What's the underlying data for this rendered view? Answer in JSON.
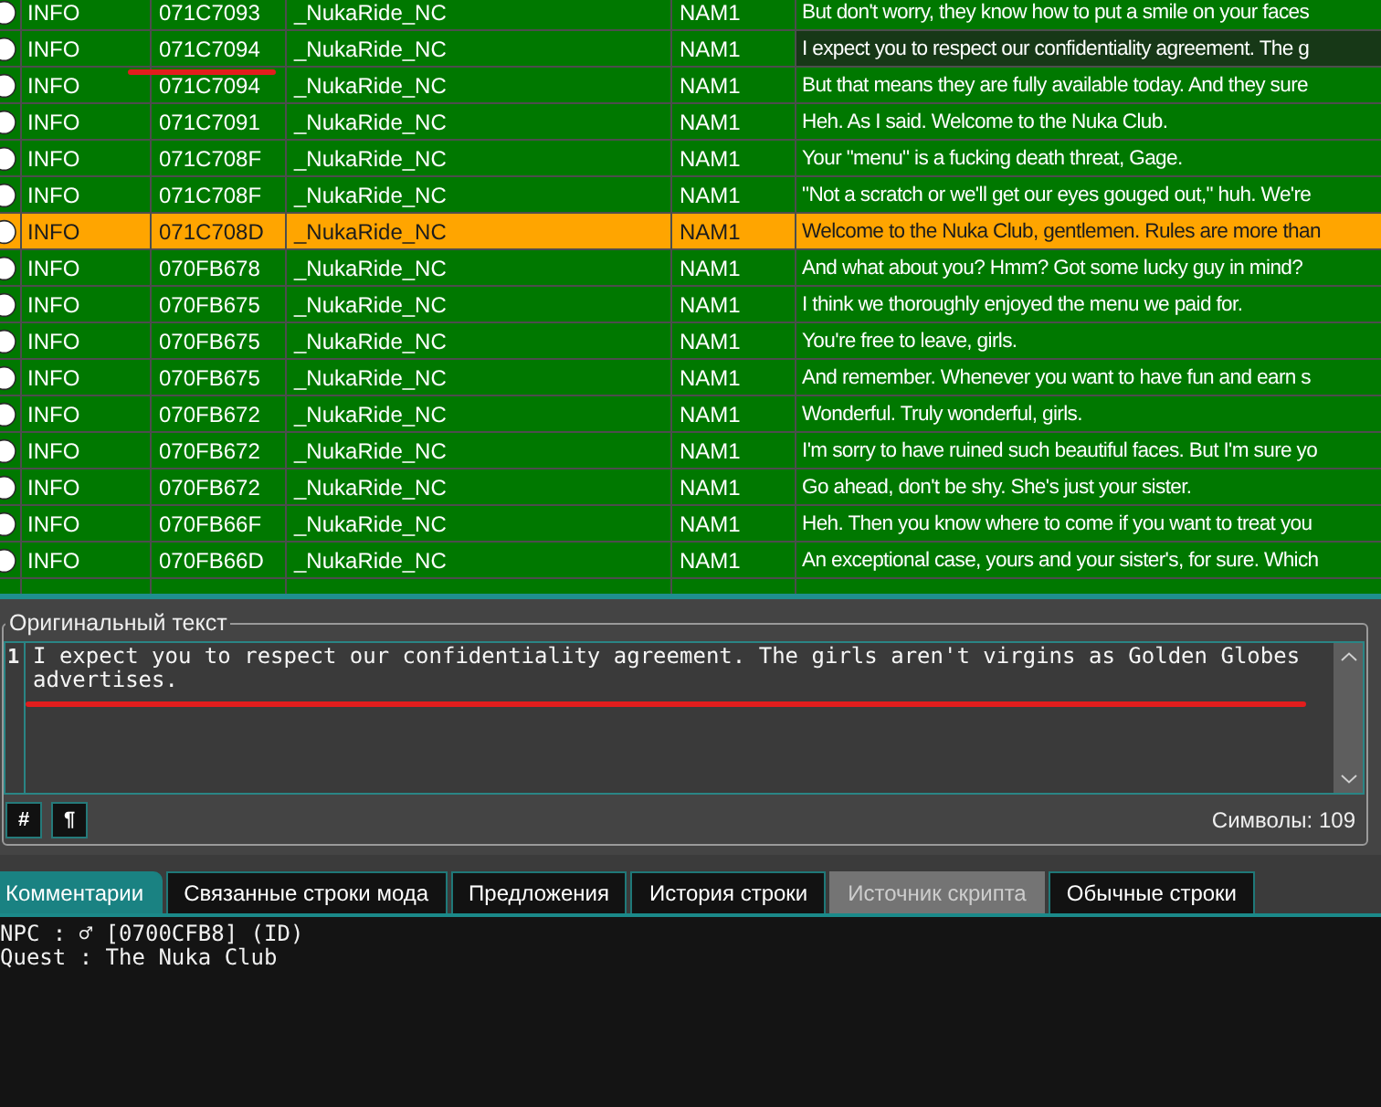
{
  "table": {
    "rows": [
      {
        "column_1": "INFO",
        "column_2": "071C7093",
        "column_3": "_NukaRide_NC",
        "column_4": "NAM1",
        "column_5": "But don't worry, they know how to put a smile on your faces",
        "color": "#007800",
        "selected": false,
        "underlined": false
      },
      {
        "column_1": "INFO",
        "column_2": "071C7094",
        "column_3": "_NukaRide_NC",
        "column_4": "NAM1",
        "column_5": "I expect you to respect our confidentiality agreement. The g",
        "color": "#007800",
        "selected": true,
        "underlined": true
      },
      {
        "column_1": "INFO",
        "column_2": "071C7094",
        "column_3": "_NukaRide_NC",
        "column_4": "NAM1",
        "column_5": "But that means they are fully available today. And they sure",
        "color": "#007800",
        "selected": false,
        "underlined": false
      },
      {
        "column_1": "INFO",
        "column_2": "071C7091",
        "column_3": "_NukaRide_NC",
        "column_4": "NAM1",
        "column_5": "Heh. As I said. Welcome to the Nuka Club.",
        "color": "#007800",
        "selected": false,
        "underlined": false
      },
      {
        "column_1": "INFO",
        "column_2": "071C708F",
        "column_3": "_NukaRide_NC",
        "column_4": "NAM1",
        "column_5": "Your \"menu\" is a fucking death threat, Gage.",
        "color": "#007800",
        "selected": false,
        "underlined": false
      },
      {
        "column_1": "INFO",
        "column_2": "071C708F",
        "column_3": "_NukaRide_NC",
        "column_4": "NAM1",
        "column_5": "\"Not a scratch or we'll get our eyes gouged out,\" huh. We're",
        "color": "#007800",
        "selected": false,
        "underlined": false
      },
      {
        "column_1": "INFO",
        "column_2": "071C708D",
        "column_3": "_NukaRide_NC",
        "column_4": "NAM1",
        "column_5": "Welcome to the Nuka Club, gentlemen. Rules are more than",
        "color": "#ffa500",
        "selected": false,
        "underlined": false
      },
      {
        "column_1": "INFO",
        "column_2": "070FB678",
        "column_3": "_NukaRide_NC",
        "column_4": "NAM1",
        "column_5": "And what about you? Hmm? Got some lucky guy in mind?",
        "color": "#007800",
        "selected": false,
        "underlined": false
      },
      {
        "column_1": "INFO",
        "column_2": "070FB675",
        "column_3": "_NukaRide_NC",
        "column_4": "NAM1",
        "column_5": "I think we thoroughly enjoyed the menu we paid for.",
        "color": "#007800",
        "selected": false,
        "underlined": false
      },
      {
        "column_1": "INFO",
        "column_2": "070FB675",
        "column_3": "_NukaRide_NC",
        "column_4": "NAM1",
        "column_5": "You're free to leave, girls.",
        "color": "#007800",
        "selected": false,
        "underlined": false
      },
      {
        "column_1": "INFO",
        "column_2": "070FB675",
        "column_3": "_NukaRide_NC",
        "column_4": "NAM1",
        "column_5": "And remember. Whenever you want to have fun and earn s",
        "color": "#007800",
        "selected": false,
        "underlined": false
      },
      {
        "column_1": "INFO",
        "column_2": "070FB672",
        "column_3": "_NukaRide_NC",
        "column_4": "NAM1",
        "column_5": "Wonderful. Truly wonderful, girls.",
        "color": "#007800",
        "selected": false,
        "underlined": false
      },
      {
        "column_1": "INFO",
        "column_2": "070FB672",
        "column_3": "_NukaRide_NC",
        "column_4": "NAM1",
        "column_5": "I'm sorry to have ruined such beautiful faces. But I'm sure yo",
        "color": "#007800",
        "selected": false,
        "underlined": false
      },
      {
        "column_1": "INFO",
        "column_2": "070FB672",
        "column_3": "_NukaRide_NC",
        "column_4": "NAM1",
        "column_5": "Go ahead, don't be shy. She's just your sister.",
        "color": "#007800",
        "selected": false,
        "underlined": false
      },
      {
        "column_1": "INFO",
        "column_2": "070FB66F",
        "column_3": "_NukaRide_NC",
        "column_4": "NAM1",
        "column_5": "Heh. Then you know where to come if you want to treat you",
        "color": "#007800",
        "selected": false,
        "underlined": false
      },
      {
        "column_1": "INFO",
        "column_2": "070FB66D",
        "column_3": "_NukaRide_NC",
        "column_4": "NAM1",
        "column_5": "An exceptional case, yours and your sister's, for sure. Which",
        "color": "#007800",
        "selected": false,
        "underlined": false
      }
    ]
  },
  "original_text": {
    "title": "Оригинальный текст",
    "line_numbers": [
      "1"
    ],
    "text": "I expect you to respect our confidentiality agreement. The girls aren't virgins as Golden Globes advertises.",
    "underlined": true,
    "buttons": [
      "#",
      "¶"
    ],
    "char_count": "Символы: 109"
  },
  "tabs": [
    {
      "label": "Комментарии",
      "selected": true,
      "disabled": false
    },
    {
      "label": "Связанные строки мода",
      "selected": false,
      "disabled": false
    },
    {
      "label": "Предложения",
      "selected": false,
      "disabled": false
    },
    {
      "label": "История строки",
      "selected": false,
      "disabled": false
    },
    {
      "label": "Источник скрипта",
      "selected": false,
      "disabled": true
    },
    {
      "label": "Обычные строки",
      "selected": false,
      "disabled": false
    }
  ],
  "details": {
    "lines": [
      "NPC : ♂ [0700CFB8] (ID)",
      "Quest : The Nuka Club"
    ]
  }
}
